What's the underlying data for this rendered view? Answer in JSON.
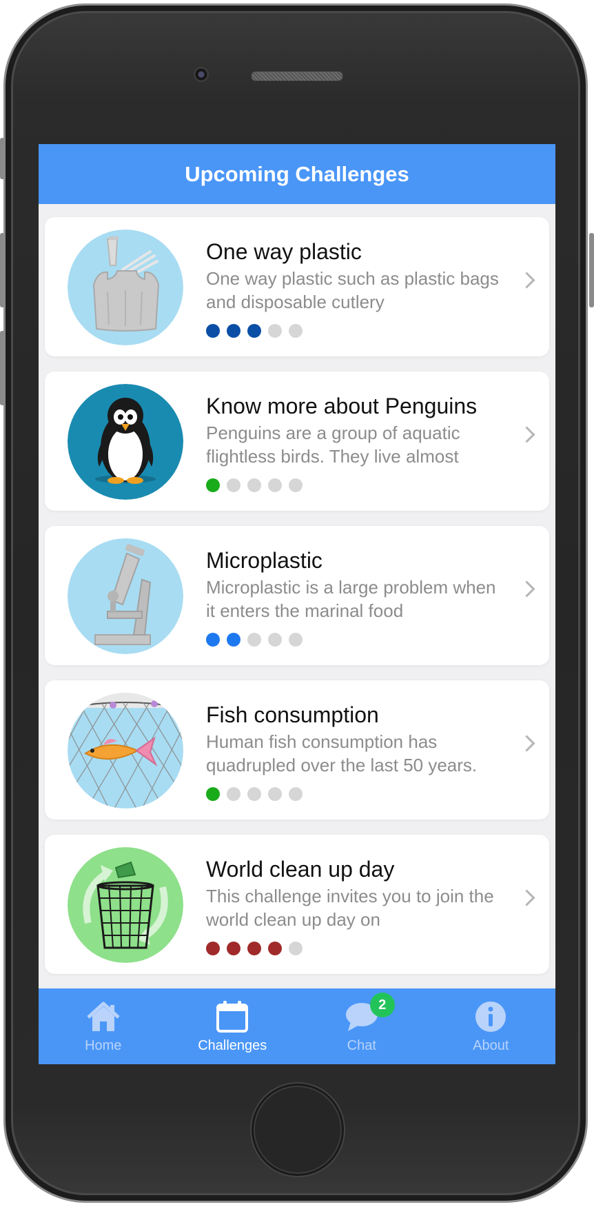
{
  "header": {
    "title": "Upcoming Challenges"
  },
  "challenges": [
    {
      "title": "One way plastic",
      "description": "One way plastic such as plastic bags and disposable cutlery",
      "icon": "plastic-bag-icon",
      "level": 3,
      "max_level": 5,
      "level_color": "#0b4ea6"
    },
    {
      "title": "Know more about Penguins",
      "description": "Penguins are a group of aquatic flightless birds. They live almost",
      "icon": "penguin-icon",
      "level": 1,
      "max_level": 5,
      "level_color": "#1aab1a"
    },
    {
      "title": "Microplastic",
      "description": "Microplastic is a large problem when it enters the marinal food",
      "icon": "microscope-icon",
      "level": 2,
      "max_level": 5,
      "level_color": "#1e78f0"
    },
    {
      "title": "Fish consumption",
      "description": "Human fish consumption has quadrupled over the last 50 years.",
      "icon": "fish-net-icon",
      "level": 1,
      "max_level": 5,
      "level_color": "#1aab1a"
    },
    {
      "title": "World clean up day",
      "description": "This challenge invites you to join the world clean up day on",
      "icon": "recycle-bin-icon",
      "level": 4,
      "max_level": 5,
      "level_color": "#a02a2a"
    }
  ],
  "tabbar": {
    "active": "Challenges",
    "tabs": [
      {
        "label": "Home",
        "icon": "home-icon"
      },
      {
        "label": "Challenges",
        "icon": "calendar-icon"
      },
      {
        "label": "Chat",
        "icon": "chat-bubble-icon",
        "badge": "2"
      },
      {
        "label": "About",
        "icon": "info-icon"
      }
    ]
  },
  "colors": {
    "accent": "#4a96f7",
    "inactive_dot": "#d6d6d6",
    "badge": "#22c45a"
  }
}
